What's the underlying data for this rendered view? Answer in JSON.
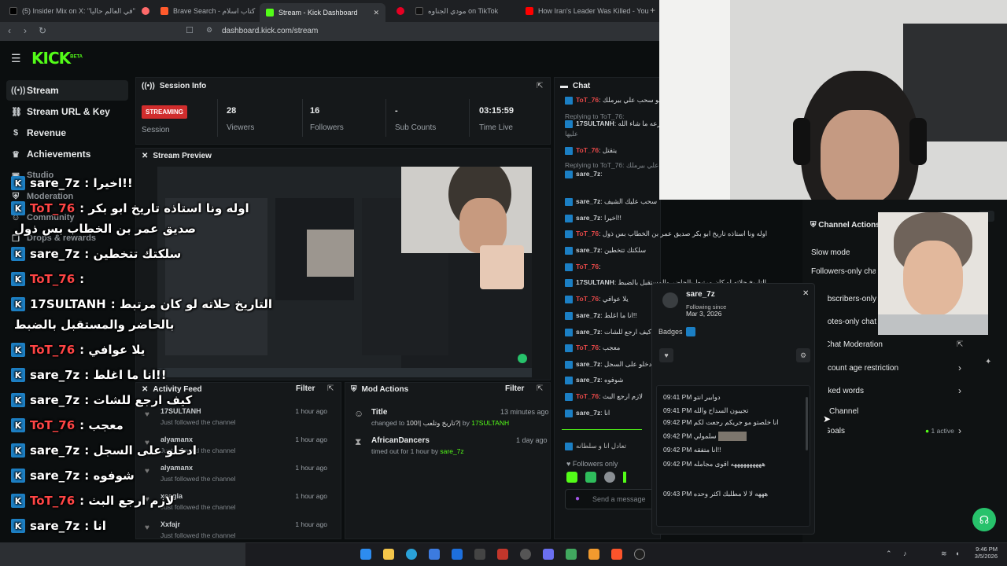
{
  "browser": {
    "tabs": [
      {
        "label": "(5) Insider Mix on X: \"في العالم حاليا\" / X",
        "color": "#444"
      },
      {
        "label": "",
        "color": "#ff6a6a"
      },
      {
        "label": "Brave Search - كتاب اسلام",
        "color": "#ff5a2c"
      },
      {
        "label": "Stream - Kick Dashboard",
        "color": "#53fc18"
      },
      {
        "label": "",
        "color": "#e60023"
      },
      {
        "label": "مودي الجناوه on TikTok",
        "color": "#111"
      },
      {
        "label": "How Iran's Leader Was Killed - YouTu...",
        "color": "#ff0000"
      }
    ],
    "url": "dashboard.kick.com/stream"
  },
  "logo": "KICK",
  "logo_sup": "BETA",
  "sidebar": [
    {
      "label": "Stream",
      "icon": "radio-icon"
    },
    {
      "label": "Stream URL & Key",
      "icon": "link-icon"
    },
    {
      "label": "Revenue",
      "icon": "dollar-icon"
    },
    {
      "label": "Achievements",
      "icon": "trophy-icon"
    },
    {
      "label": "Studio",
      "icon": "studio-icon"
    },
    {
      "label": "Moderation",
      "icon": "shield-icon"
    },
    {
      "label": "Community",
      "icon": "users-icon"
    },
    {
      "label": "Drops & rewards",
      "icon": "gift-icon"
    }
  ],
  "session": {
    "title": "Session Info",
    "status": "STREAMING",
    "status_label": "Session",
    "stats": [
      {
        "value": "28",
        "label": "Viewers"
      },
      {
        "value": "16",
        "label": "Followers"
      },
      {
        "value": "-",
        "label": "Sub Counts"
      },
      {
        "value": "03:15:59",
        "label": "Time Live"
      }
    ]
  },
  "preview": {
    "title": "Stream Preview"
  },
  "activity": {
    "title": "Activity Feed",
    "filter": "Filter",
    "rows": [
      {
        "name": "17SULTANH",
        "sub": "Just followed the channel",
        "time": "1 hour ago"
      },
      {
        "name": "alyamanx",
        "sub": "Just followed the channel",
        "time": "1 hour ago"
      },
      {
        "name": "alyamanx",
        "sub": "Just followed the channel",
        "time": "1 hour ago"
      },
      {
        "name": "xcagla",
        "sub": "Just followed the channel",
        "time": "1 hour ago"
      },
      {
        "name": "Xxfajr",
        "sub": "Just followed the channel",
        "time": "1 hour ago"
      }
    ]
  },
  "modactions": {
    "title": "Mod Actions",
    "filter": "Filter",
    "rows": [
      {
        "name": "Title",
        "pre": "changed to",
        "val": "تاريخ وتلعب |!100?|",
        "by": "by",
        "user": "17SULTANH",
        "time": "13 minutes ago"
      },
      {
        "name": "AfricanDancers",
        "pre": "timed out for 1 hour by",
        "val": "",
        "by": "",
        "user": "sare_7z",
        "time": "1 day ago"
      }
    ]
  },
  "chat": {
    "title": "Chat",
    "lines": [
      {
        "user": "ToT_76",
        "text": "لو سحب علي بيرملك"
      },
      {
        "user": "",
        "text": "Replying to ToT_76:"
      },
      {
        "user": "17SULTANH",
        "text": "صرعه ما شاء الله"
      },
      {
        "user": "",
        "text": "عليها"
      },
      {
        "user": "ToT_76",
        "text": "يتقتل"
      },
      {
        "user": "",
        "text": "Replying to ToT_76: لو سحب علي بيرملك"
      },
      {
        "user": "sare_7z",
        "text": ""
      },
      {
        "user": "sare_7z",
        "text": "سحب عليك الشيف"
      },
      {
        "user": "sare_7z",
        "text": "اخيرا!!"
      },
      {
        "user": "ToT_76",
        "text": "اوله ونا استاذه تاريخ ابو بكر صديق عمر بن الخطاب بس ذول"
      },
      {
        "user": "sare_7z",
        "text": "سلكتك تتخطين"
      },
      {
        "user": "ToT_76",
        "text": ""
      },
      {
        "user": "17SULTANH",
        "text": "التاريخ حلاته لو كان مرتبط بالحاضر والمستقبل بالضبط"
      },
      {
        "user": "ToT_76",
        "text": "يلا عوافي"
      },
      {
        "user": "sare_7z",
        "text": "انا ما اغلط!!"
      },
      {
        "user": "sare_7z",
        "text": "كيف ارجع للشات"
      },
      {
        "user": "ToT_76",
        "text": "معجب"
      },
      {
        "user": "sare_7z",
        "text": "ادخلو على السجل"
      },
      {
        "user": "sare_7z",
        "text": "شوفوه"
      },
      {
        "user": "ToT_76",
        "text": "لازم ارجع البث"
      },
      {
        "user": "sare_7z",
        "text": "انا"
      }
    ],
    "last_line": "تعادل انا و سلطانه",
    "followers_only": "Followers only",
    "send_placeholder": "Send a message"
  },
  "overlay": [
    {
      "user": "sare_7z",
      "text": ": اخيرا!!",
      "red": false
    },
    {
      "user": "ToT_76",
      "text": ": اوله ونا استاذه تاريخ ابو بكر",
      "red": true
    },
    {
      "user": "",
      "text": "صديق عمر بن الخطاب بس ذول",
      "red": false
    },
    {
      "user": "sare_7z",
      "text": ": سلكتك تتخطين",
      "red": false
    },
    {
      "user": "ToT_76",
      "text": ":",
      "red": true
    },
    {
      "user": "17SULTANH",
      "text": ": التاريخ حلاته لو كان مرتبط",
      "red": false
    },
    {
      "user": "",
      "text": "بالحاضر والمستقبل بالضبط",
      "red": false
    },
    {
      "user": "ToT_76",
      "text": ": يلا عوافي",
      "red": true
    },
    {
      "user": "sare_7z",
      "text": ": انا ما اغلط!!",
      "red": false
    },
    {
      "user": "sare_7z",
      "text": ": كيف ارجع للشات",
      "red": false
    },
    {
      "user": "ToT_76",
      "text": ": معجب",
      "red": true
    },
    {
      "user": "sare_7z",
      "text": ": ادخلو على السجل",
      "red": false
    },
    {
      "user": "sare_7z",
      "text": ": شوفوه",
      "red": false
    },
    {
      "user": "ToT_76",
      "text": ": لازم ارجع البث",
      "red": true
    },
    {
      "user": "sare_7z",
      "text": ": انا",
      "red": false
    },
    {
      "user": "ToT_76",
      "text": ": تعادل انا و سلطانه",
      "red": true
    }
  ],
  "userpopup": {
    "username": "sare_7z",
    "following_since": "Following since",
    "date": "Mar 3, 2026",
    "badges": "Badges",
    "messages": [
      {
        "time": "09:41 PM",
        "text": "دوابير انتو"
      },
      {
        "time": "09:41 PM",
        "text": "تجيبون السداح والله"
      },
      {
        "time": "09:42 PM",
        "text": "انا خلصتو مو جريكم رجعت لكم"
      },
      {
        "time": "09:42 PM",
        "text": "سلمولي"
      },
      {
        "time": "09:42 PM",
        "text": "انا متفقه!!"
      },
      {
        "time": "09:42 PM",
        "text": "ههههههههههه اقوى مجامله"
      },
      {
        "time": "09:43 PM",
        "text": "هههه لا لا مطلبك اكثر وحده"
      }
    ]
  },
  "channel_actions": {
    "title": "Channel Actions",
    "items": [
      "Slow mode",
      "Followers-only chat",
      "Subscribers-only",
      "Emotes-only chat",
      "Chat Moderation",
      "Account age restriction",
      "Blocked words",
      "Channel",
      "Goals"
    ],
    "goals_status": "1 active"
  },
  "taskbar": {
    "time": "9:46 PM",
    "date": "3/5/2026"
  }
}
